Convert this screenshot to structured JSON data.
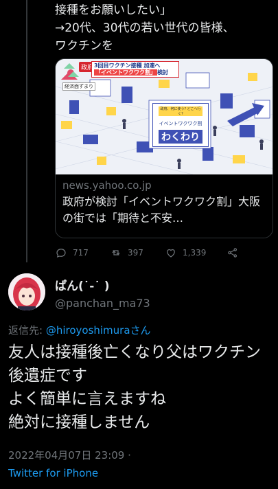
{
  "quoted_tweet": {
    "text": "接種をお願いしたい」\n→20代、30代の若い世代の皆様、\nワクチンを",
    "card": {
      "badge": "政府",
      "headline_line1": "3回目ワクチン接種 加速へ",
      "headline_highlight": "「イベントワクワク割」",
      "headline_suffix": "検討",
      "small_label": "経済面ずまり",
      "sign_top": "政府、何に使う? どこへ行く?",
      "sign_middle": "イベントワクワク割",
      "sign_main": "わくわり",
      "domain": "news.yahoo.co.jp",
      "title": "政府が検討「イベントワクワク割」大阪の街では「期待と不安…"
    },
    "actions": {
      "reply_count": "717",
      "retweet_count": "397",
      "like_count": "1,339"
    }
  },
  "reply_tweet": {
    "display_name": "ぱん(˙-˙ )",
    "handle": "@panchan_ma73",
    "reply_label": "返信先: ",
    "reply_mention": "@hiroyoshimuraさん",
    "text": "友人は接種後亡くなり父はワクチン後遺症です\nよく簡単に言えますね\n絶対に接種しません",
    "timestamp": "2022年04月07日 23:09 ·",
    "source": "Twitter for iPhone"
  },
  "colors": {
    "background": "#000000",
    "text": "#e7e9ea",
    "secondary": "#71767b",
    "link": "#1d9bf0",
    "border": "#2f3336"
  },
  "icons": {
    "reply": "reply-icon",
    "retweet": "retweet-icon",
    "like": "heart-icon",
    "share": "share-icon"
  }
}
